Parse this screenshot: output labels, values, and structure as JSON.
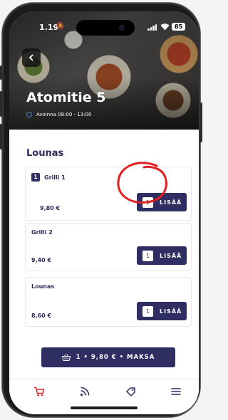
{
  "status_bar": {
    "time": "1.19",
    "battery": "85"
  },
  "restaurant": {
    "name": "Atomitie 5",
    "hours": "Avoinna 08:00 - 13:00"
  },
  "section": {
    "title": "Lounas"
  },
  "items": [
    {
      "name": "Grilli 1",
      "price": "9,80 €",
      "cart_qty": "1",
      "qty": "1",
      "add_label": "LISÄÄ"
    },
    {
      "name": "Grilli 2",
      "price": "9,40 €",
      "qty": "1",
      "add_label": "LISÄÄ"
    },
    {
      "name": "Lounas",
      "price": "8,60 €",
      "qty": "1",
      "add_label": "LISÄÄ"
    }
  ],
  "cart_button": {
    "label": "1 • 9,80 € • MAKSA"
  },
  "tabs": [
    {
      "icon": "cart-icon",
      "active": true
    },
    {
      "icon": "rss-feed-icon",
      "active": false
    },
    {
      "icon": "tag-icon",
      "active": false
    },
    {
      "icon": "menu-icon",
      "active": false
    }
  ],
  "colors": {
    "primary": "#2e2e63",
    "accent_red": "#d62b2b",
    "annotation_red": "#e02020"
  }
}
